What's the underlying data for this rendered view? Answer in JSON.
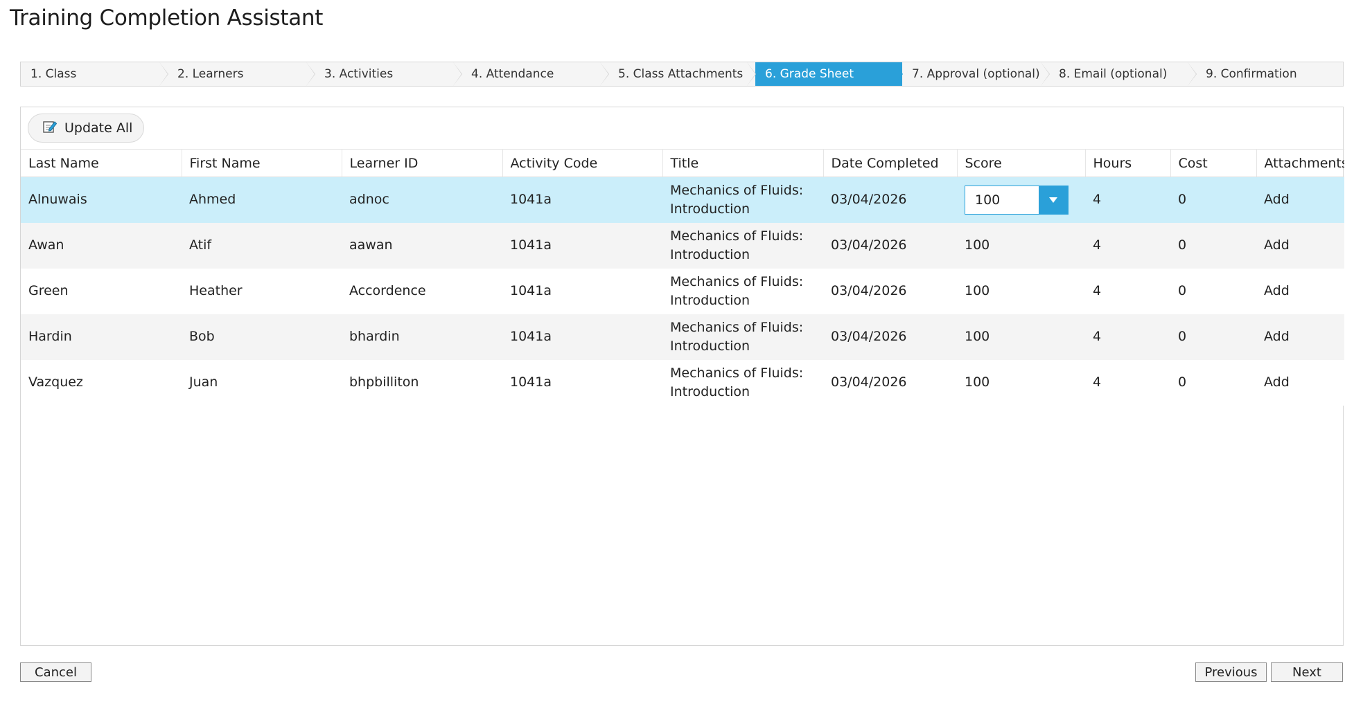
{
  "window": {
    "title": "Training Completion Assistant"
  },
  "wizard": {
    "active_index": 5,
    "steps": [
      "1. Class",
      "2. Learners",
      "3. Activities",
      "4. Attendance",
      "5. Class Attachments",
      "6. Grade Sheet",
      "7. Approval (optional)",
      "8. Email (optional)",
      "9. Confirmation"
    ]
  },
  "toolbar": {
    "update_all_label": "Update All"
  },
  "grid": {
    "columns": [
      "Last Name",
      "First Name",
      "Learner ID",
      "Activity Code",
      "Title",
      "Date Completed",
      "Score",
      "Hours",
      "Cost",
      "Attachments"
    ],
    "rows": [
      {
        "last": "Alnuwais",
        "first": "Ahmed",
        "id": "adnoc",
        "code": "1041a",
        "title_line1": "Mechanics of Fluids:",
        "title_line2": "Introduction",
        "date": "03/04/2026",
        "score": "100",
        "hours": "4",
        "cost": "0",
        "attachments": "Add"
      },
      {
        "last": "Awan",
        "first": "Atif",
        "id": "aawan",
        "code": "1041a",
        "title_line1": "Mechanics of Fluids:",
        "title_line2": "Introduction",
        "date": "03/04/2026",
        "score": "100",
        "hours": "4",
        "cost": "0",
        "attachments": "Add"
      },
      {
        "last": "Green",
        "first": "Heather",
        "id": "Accordence",
        "code": "1041a",
        "title_line1": "Mechanics of Fluids:",
        "title_line2": "Introduction",
        "date": "03/04/2026",
        "score": "100",
        "hours": "4",
        "cost": "0",
        "attachments": "Add"
      },
      {
        "last": "Hardin",
        "first": "Bob",
        "id": "bhardin",
        "code": "1041a",
        "title_line1": "Mechanics of Fluids:",
        "title_line2": "Introduction",
        "date": "03/04/2026",
        "score": "100",
        "hours": "4",
        "cost": "0",
        "attachments": "Add"
      },
      {
        "last": "Vazquez",
        "first": "Juan",
        "id": "bhpbilliton",
        "code": "1041a",
        "title_line1": "Mechanics of Fluids:",
        "title_line2": "Introduction",
        "date": "03/04/2026",
        "score": "100",
        "hours": "4",
        "cost": "0",
        "attachments": "Add"
      }
    ]
  },
  "footer": {
    "cancel_label": "Cancel",
    "previous_label": "Previous",
    "next_label": "Next"
  },
  "colors": {
    "accent": "#2aa0d9",
    "selected_row": "#cbeefa",
    "alt_row": "#f4f4f4"
  },
  "icons": {
    "update_all": "edit-note-icon",
    "score_dropdown": "chevron-down-icon"
  }
}
